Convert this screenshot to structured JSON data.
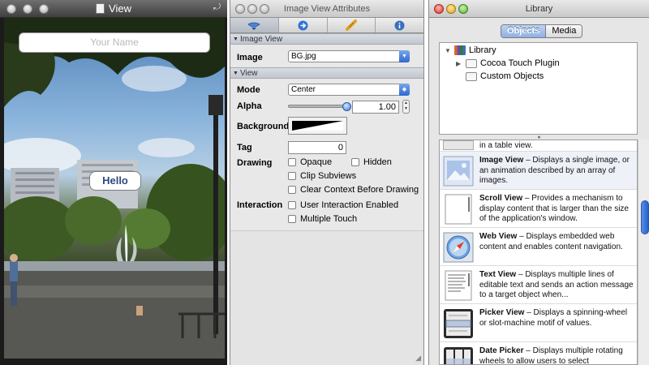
{
  "view_window": {
    "title": "View",
    "name_placeholder": "Your Name",
    "hello_label": "Hello"
  },
  "inspector": {
    "title": "Image View Attributes",
    "tabs": [
      {
        "icon": "attributes-tab-icon"
      },
      {
        "icon": "connections-tab-icon"
      },
      {
        "icon": "size-tab-icon"
      },
      {
        "icon": "identity-tab-icon"
      }
    ],
    "section_image_view": "Image View",
    "image_label": "Image",
    "image_value": "BG.jpg",
    "section_view": "View",
    "mode_label": "Mode",
    "mode_value": "Center",
    "alpha_label": "Alpha",
    "alpha_value": "1.00",
    "alpha_level": 1.0,
    "background_label": "Background",
    "tag_label": "Tag",
    "tag_value": "0",
    "drawing_label": "Drawing",
    "opaque_label": "Opaque",
    "hidden_label": "Hidden",
    "clip_label": "Clip Subviews",
    "clear_label": "Clear Context Before Drawing",
    "interaction_label": "Interaction",
    "user_interaction_label": "User Interaction Enabled",
    "multiple_touch_label": "Multiple Touch"
  },
  "library": {
    "title": "Library",
    "seg_objects": "Objects",
    "seg_media": "Media",
    "tree": [
      {
        "label": "Library",
        "disclosure": "▼",
        "icon": "library-books-icon"
      },
      {
        "label": "Cocoa Touch Plugin",
        "disclosure": "▶",
        "icon": "folder-icon"
      },
      {
        "label": "Custom Objects",
        "disclosure": "",
        "icon": "folder-icon"
      }
    ],
    "partial_text": "in a table view.",
    "items": [
      {
        "name": "Image View",
        "desc": " – Displays a single image, or an animation described by an array of images."
      },
      {
        "name": "Scroll View",
        "desc": " – Provides a mechanism to display content that is larger than the size of the application's window."
      },
      {
        "name": "Web View",
        "desc": " – Displays embedded web content and enables content navigation."
      },
      {
        "name": "Text View",
        "desc": " – Displays multiple lines of editable text and sends an action message to a target object when..."
      },
      {
        "name": "Picker View",
        "desc": " – Displays a spinning-wheel or slot-machine motif of values."
      },
      {
        "name": "Date Picker",
        "desc": " – Displays multiple rotating wheels to allow users to select"
      }
    ]
  },
  "colors": {
    "accent_blue": "#2d6ad3",
    "hello_text": "#2e4a7d"
  }
}
